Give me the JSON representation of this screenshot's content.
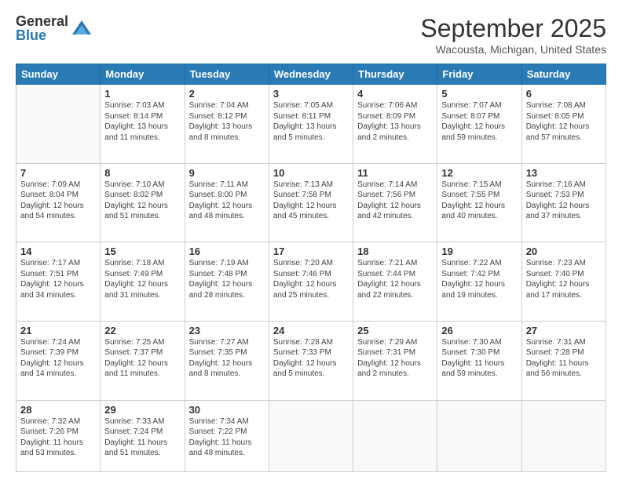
{
  "logo": {
    "general": "General",
    "blue": "Blue"
  },
  "header": {
    "title": "September 2025",
    "location": "Wacousta, Michigan, United States"
  },
  "weekdays": [
    "Sunday",
    "Monday",
    "Tuesday",
    "Wednesday",
    "Thursday",
    "Friday",
    "Saturday"
  ],
  "weeks": [
    [
      {
        "day": "",
        "info": ""
      },
      {
        "day": "1",
        "info": "Sunrise: 7:03 AM\nSunset: 8:14 PM\nDaylight: 13 hours\nand 11 minutes."
      },
      {
        "day": "2",
        "info": "Sunrise: 7:04 AM\nSunset: 8:12 PM\nDaylight: 13 hours\nand 8 minutes."
      },
      {
        "day": "3",
        "info": "Sunrise: 7:05 AM\nSunset: 8:11 PM\nDaylight: 13 hours\nand 5 minutes."
      },
      {
        "day": "4",
        "info": "Sunrise: 7:06 AM\nSunset: 8:09 PM\nDaylight: 13 hours\nand 2 minutes."
      },
      {
        "day": "5",
        "info": "Sunrise: 7:07 AM\nSunset: 8:07 PM\nDaylight: 12 hours\nand 59 minutes."
      },
      {
        "day": "6",
        "info": "Sunrise: 7:08 AM\nSunset: 8:05 PM\nDaylight: 12 hours\nand 57 minutes."
      }
    ],
    [
      {
        "day": "7",
        "info": "Sunrise: 7:09 AM\nSunset: 8:04 PM\nDaylight: 12 hours\nand 54 minutes."
      },
      {
        "day": "8",
        "info": "Sunrise: 7:10 AM\nSunset: 8:02 PM\nDaylight: 12 hours\nand 51 minutes."
      },
      {
        "day": "9",
        "info": "Sunrise: 7:11 AM\nSunset: 8:00 PM\nDaylight: 12 hours\nand 48 minutes."
      },
      {
        "day": "10",
        "info": "Sunrise: 7:13 AM\nSunset: 7:58 PM\nDaylight: 12 hours\nand 45 minutes."
      },
      {
        "day": "11",
        "info": "Sunrise: 7:14 AM\nSunset: 7:56 PM\nDaylight: 12 hours\nand 42 minutes."
      },
      {
        "day": "12",
        "info": "Sunrise: 7:15 AM\nSunset: 7:55 PM\nDaylight: 12 hours\nand 40 minutes."
      },
      {
        "day": "13",
        "info": "Sunrise: 7:16 AM\nSunset: 7:53 PM\nDaylight: 12 hours\nand 37 minutes."
      }
    ],
    [
      {
        "day": "14",
        "info": "Sunrise: 7:17 AM\nSunset: 7:51 PM\nDaylight: 12 hours\nand 34 minutes."
      },
      {
        "day": "15",
        "info": "Sunrise: 7:18 AM\nSunset: 7:49 PM\nDaylight: 12 hours\nand 31 minutes."
      },
      {
        "day": "16",
        "info": "Sunrise: 7:19 AM\nSunset: 7:48 PM\nDaylight: 12 hours\nand 28 minutes."
      },
      {
        "day": "17",
        "info": "Sunrise: 7:20 AM\nSunset: 7:46 PM\nDaylight: 12 hours\nand 25 minutes."
      },
      {
        "day": "18",
        "info": "Sunrise: 7:21 AM\nSunset: 7:44 PM\nDaylight: 12 hours\nand 22 minutes."
      },
      {
        "day": "19",
        "info": "Sunrise: 7:22 AM\nSunset: 7:42 PM\nDaylight: 12 hours\nand 19 minutes."
      },
      {
        "day": "20",
        "info": "Sunrise: 7:23 AM\nSunset: 7:40 PM\nDaylight: 12 hours\nand 17 minutes."
      }
    ],
    [
      {
        "day": "21",
        "info": "Sunrise: 7:24 AM\nSunset: 7:39 PM\nDaylight: 12 hours\nand 14 minutes."
      },
      {
        "day": "22",
        "info": "Sunrise: 7:25 AM\nSunset: 7:37 PM\nDaylight: 12 hours\nand 11 minutes."
      },
      {
        "day": "23",
        "info": "Sunrise: 7:27 AM\nSunset: 7:35 PM\nDaylight: 12 hours\nand 8 minutes."
      },
      {
        "day": "24",
        "info": "Sunrise: 7:28 AM\nSunset: 7:33 PM\nDaylight: 12 hours\nand 5 minutes."
      },
      {
        "day": "25",
        "info": "Sunrise: 7:29 AM\nSunset: 7:31 PM\nDaylight: 12 hours\nand 2 minutes."
      },
      {
        "day": "26",
        "info": "Sunrise: 7:30 AM\nSunset: 7:30 PM\nDaylight: 11 hours\nand 59 minutes."
      },
      {
        "day": "27",
        "info": "Sunrise: 7:31 AM\nSunset: 7:28 PM\nDaylight: 11 hours\nand 56 minutes."
      }
    ],
    [
      {
        "day": "28",
        "info": "Sunrise: 7:32 AM\nSunset: 7:26 PM\nDaylight: 11 hours\nand 53 minutes."
      },
      {
        "day": "29",
        "info": "Sunrise: 7:33 AM\nSunset: 7:24 PM\nDaylight: 11 hours\nand 51 minutes."
      },
      {
        "day": "30",
        "info": "Sunrise: 7:34 AM\nSunset: 7:22 PM\nDaylight: 11 hours\nand 48 minutes."
      },
      {
        "day": "",
        "info": ""
      },
      {
        "day": "",
        "info": ""
      },
      {
        "day": "",
        "info": ""
      },
      {
        "day": "",
        "info": ""
      }
    ]
  ]
}
